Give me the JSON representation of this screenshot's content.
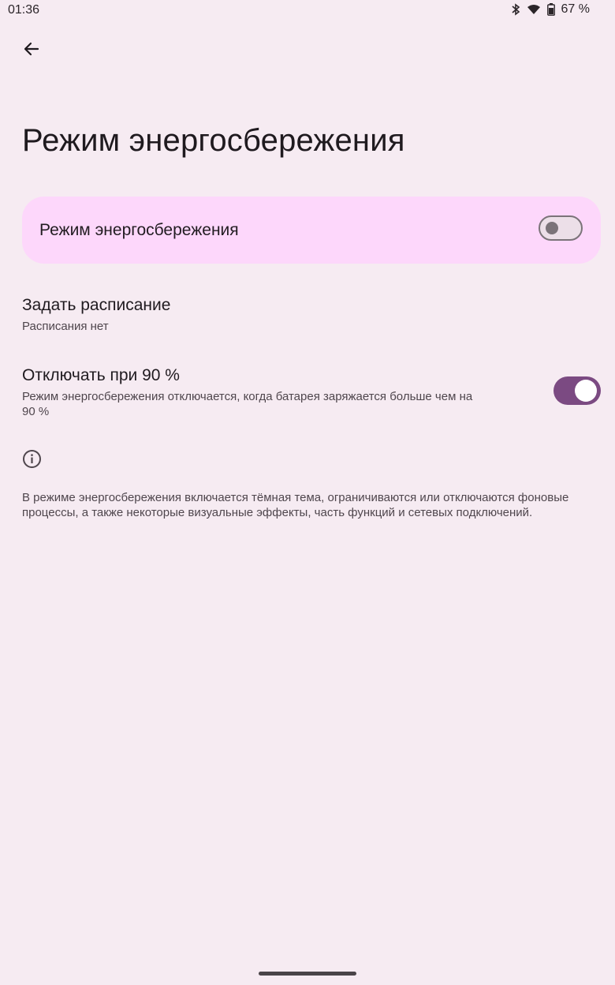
{
  "status_bar": {
    "time": "01:36",
    "battery_percent": "67 %",
    "icons": [
      "bluetooth-icon",
      "wifi-icon",
      "battery-icon"
    ]
  },
  "header": {
    "back_icon": "arrow-back-icon",
    "title": "Режим энергосбережения"
  },
  "battery_saver_toggle": {
    "label": "Режим энергосбережения",
    "enabled": false
  },
  "schedule": {
    "title": "Задать расписание",
    "summary": "Расписания нет"
  },
  "turn_off_at": {
    "title": "Отключать при 90 %",
    "summary_line1": "Режим энергосбережения отключается, когда батарея заряжается больше чем на",
    "summary_line2": "90 %",
    "enabled": true
  },
  "info": {
    "icon": "info-icon",
    "text": "В режиме энергосбережения включается тёмная тема, ограничиваются или отключаются фоновые процессы, а также некоторые визуальные эффекты, часть функций и сетевых подключений."
  },
  "colors": {
    "background": "#f6ebf2",
    "card": "#fdd7fb",
    "accent": "#7b4a82"
  }
}
